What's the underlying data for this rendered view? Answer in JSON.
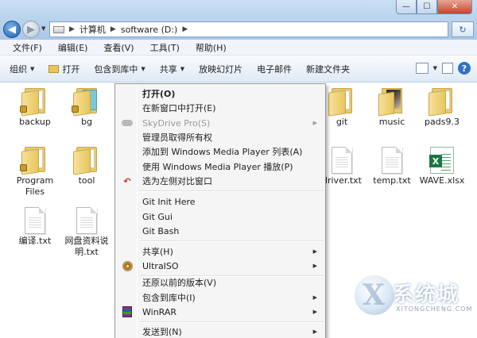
{
  "window": {
    "min_glyph": "—",
    "max_glyph": "☐",
    "close_glyph": "✕"
  },
  "address": {
    "segments": [
      "计算机",
      "software (D:)"
    ],
    "refresh_glyph": "↻"
  },
  "menubar": {
    "items": [
      "文件(F)",
      "编辑(E)",
      "查看(V)",
      "工具(T)",
      "帮助(H)"
    ]
  },
  "commandbar": {
    "items": [
      "组织",
      "打开",
      "包含到库中",
      "共享",
      "放映幻灯片",
      "电子邮件",
      "新建文件夹"
    ],
    "help_glyph": "?"
  },
  "files": [
    {
      "name": "backup",
      "kind": "folder-locked"
    },
    {
      "name": "bg",
      "kind": "folder-bg"
    },
    {
      "name": "Program Files",
      "kind": "folder-locked"
    },
    {
      "name": "tool",
      "kind": "folder"
    },
    {
      "name": "编译.txt",
      "kind": "txt"
    },
    {
      "name": "网盘资料说明.txt",
      "kind": "txt"
    },
    {
      "name": "git",
      "kind": "folder"
    },
    {
      "name": "music",
      "kind": "folder-img"
    },
    {
      "name": "pads9.3",
      "kind": "folder"
    },
    {
      "name": "driver.txt",
      "kind": "txt"
    },
    {
      "name": "temp.txt",
      "kind": "txt"
    },
    {
      "name": "WAVE.xlsx",
      "kind": "xlsx"
    }
  ],
  "context_menu": {
    "items": [
      {
        "label": "打开(O)"
      },
      {
        "label": "在新窗口中打开(E)"
      },
      {
        "label": "SkyDrive Pro(S)",
        "icon": "skydrive-cloud-icon"
      },
      {
        "label": "管理员取得所有权"
      },
      {
        "label": "添加到 Windows Media Player 列表(A)"
      },
      {
        "label": "使用 Windows Media Player 播放(P)"
      },
      {
        "label": "选为左侧对比窗口",
        "icon": "undo-arrow-icon"
      },
      {
        "label": "Git Init Here"
      },
      {
        "label": "Git Gui"
      },
      {
        "label": "Git Bash"
      },
      {
        "label": "共享(H)"
      },
      {
        "label": "UltraISO",
        "icon": "ultraiso-disc-icon"
      },
      {
        "label": "还原以前的版本(V)"
      },
      {
        "label": "包含到库中(I)"
      },
      {
        "label": "WinRAR",
        "icon": "winrar-books-icon"
      },
      {
        "label": "发送到(N)"
      }
    ],
    "submenu_glyph": "▶"
  },
  "watermark": {
    "text": "系统城",
    "sub": "XITONGCHENG.COM"
  }
}
